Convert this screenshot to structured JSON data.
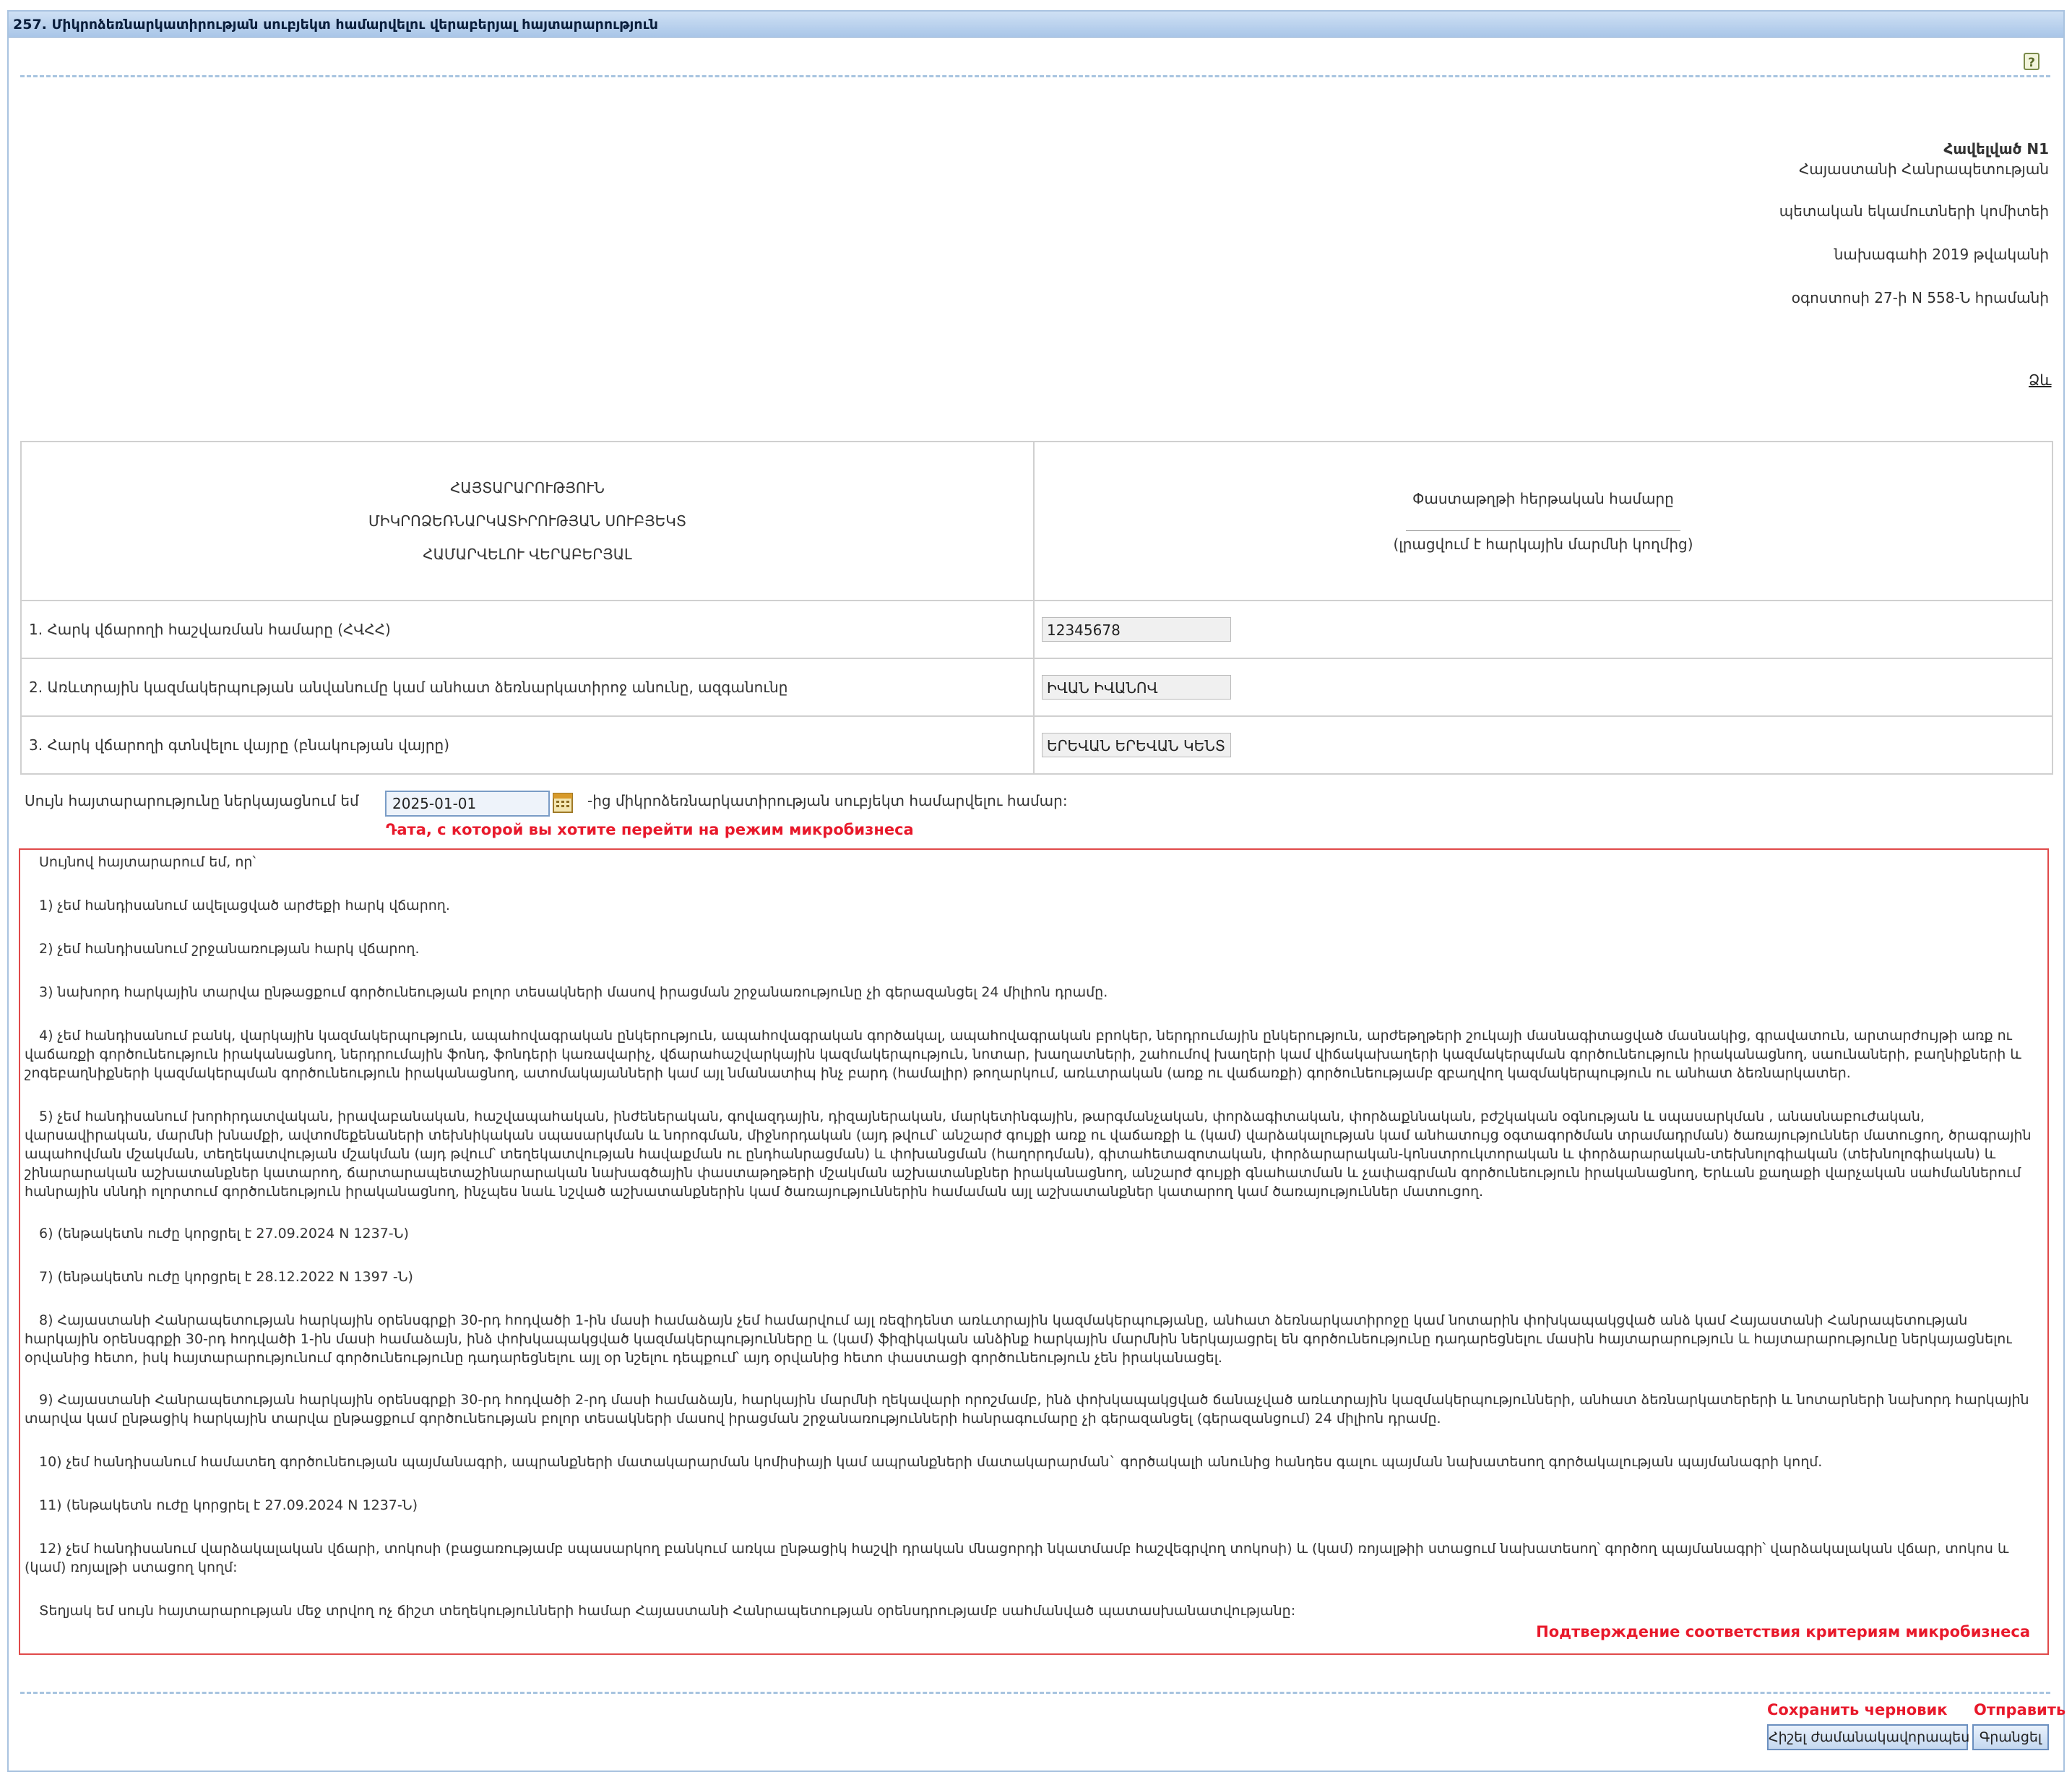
{
  "window": {
    "title": "257. Միկրոձեռնարկատիրության սուբյեկտ համարվելու վերաբերյալ հայտարարություն"
  },
  "appendix": {
    "line1": "Հավելված N1",
    "line2": "Հայաստանի Հանրապետության",
    "line3": "պետական եկամուտների կոմիտեի",
    "line4": "նախագահի 2019 թվականի",
    "line5": "օգոստոսի 27-ի N 558-Ն հրամանի",
    "form_link": "Ձև"
  },
  "header": {
    "title1": "ՀԱՅՏԱՐԱՐՈՒԹՅՈՒՆ",
    "title2": "ՄԻԿՐՈՁԵՌՆԱՐԿԱՏԻՐՈՒԹՅԱՆ ՍՈՒԲՅԵԿՏ",
    "title3": "ՀԱՄԱՐՎԵԼՈՒ ՎԵՐԱԲԵՐՅԱԼ",
    "doc_number_label": "Փաստաթղթի հերթական համարը",
    "doc_number_note": "(լրացվում է հարկային մարմնի կողմից)"
  },
  "fields": [
    {
      "label": "1. Հարկ վճարողի հաշվառման համարը (ՀՎՀՀ)",
      "value": "12345678"
    },
    {
      "label": "2. Առևտրային կազմակերպության անվանումը կամ անհատ ձեռնարկատիրոջ անունը, ազգանունը",
      "value": "ԻՎԱՆ ԻՎԱՆՈՎ"
    },
    {
      "label": "3. Հարկ վճարողի գտնվելու վայրը (բնակության վայրը)",
      "value": "ԵՐԵՎԱՆ ԵՐԵՎԱՆ ԿԵՆՏ"
    }
  ],
  "date_row": {
    "label": "Սույն հայտարարությունը ներկայացնում եմ",
    "value": "2025-01-01",
    "suffix": "-ից միկրոձեռնարկատիրության սուբյեկտ համարվելու համար:",
    "note": "Դата, с которой вы хотите перейти на режим микробизнеса"
  },
  "declaration": {
    "intro": "Սույնով հայտարարում եմ, որ՝",
    "items": [
      "1) չեմ հանդիսանում ավելացված արժեքի հարկ վճարող.",
      "2) չեմ հանդիսանում շրջանառության հարկ վճարող.",
      "3) նախորդ հարկային տարվա ընթացքում գործունեության բոլոր տեսակների մասով իրացման շրջանառությունը չի գերազանցել 24 միլիոն դրամը.",
      "4) չեմ հանդիսանում բանկ, վարկային կազմակերպություն, ապահովագրական ընկերություն, ապահովագրական գործակալ, ապահովագրական բրոկեր, ներդրումային ընկերություն, արժեթղթերի շուկայի մասնագիտացված մասնակից, գրավատուն, արտարժույթի առք ու վաճառքի գործունեություն իրականացնող, ներդրումային ֆոնդ, ֆոնդերի կառավարիչ, վճարահաշվարկային կազմակերպություն, նոտար, խաղատների, շահումով խաղերի կամ վիճակախաղերի կազմակերպման գործունեություն իրականացնող, սաունաների, բաղնիքների և շոգեբաղնիքների կազմակերպման գործունեություն իրականացնող, ատոմակայանների կամ այլ նմանատիպ ինչ բարդ (համալիր) թողարկում, առևտրական (առք ու վաճառքի) գործունեությամբ զբաղվող կազմակերպություն ու անհատ ձեռնարկատեր.",
      "5) չեմ հանդիսանում խորհրդատվական, իրավաբանական, հաշվապահական, ինժեներական, գովազդային, դիզայներական, մարկետինգային, թարգմանչական, փորձագիտական, փորձաքննական, բժշկական օգնության և սպասարկման , անասնաբուժական, վարսավիրական, մարմնի խնամքի, ավտոմեքենաների տեխնիկական սպասարկման և նորոգման, միջնորդական (այդ թվում՝ անշարժ գույքի առք ու վաճառքի և (կամ) վարձակալության կամ անհատույց օգտագործման տրամադրման) ծառայություններ մատուցող, ծրագրային ապահովման մշակման, տեղեկատվության մշակման (այդ թվում՝ տեղեկատվության հավաքման ու ընդհանրացման) և փոխանցման (հաղորդման), գիտահետազոտական, փորձարարական-կոնստրուկտորական և փորձարարական-տեխնոլոգիական (տեխնոլոգիական) և շինարարական աշխատանքներ կատարող, ճարտարապետաշինարարական նախագծային փաստաթղթերի մշակման աշխատանքներ իրականացնող, անշարժ գույքի գնահատման և չափագրման գործունեություն իրականացնող, Երևան քաղաքի վարչական սահմաններում հանրային սննդի ոլորտում գործունեություն իրականացնող, ինչպես նաև նշված աշխատանքներին կամ ծառայություններին համաման այլ աշխատանքներ կատարող կամ ծառայություններ մատուցող.",
      "6) (ենթակետն ուժը կորցրել է 27.09.2024 N 1237-Ն)",
      "7) (ենթակետն ուժը կորցրել է 28.12.2022 N 1397 -Ն)",
      "8) Հայաստանի Հանրապետության հարկային օրենսգրքի 30-րդ հոդվածի 1-ին մասի համաձայն չեմ համարվում այլ ռեզիդենտ առևտրային կազմակերպությանը, անհատ ձեռնարկատիրոջը կամ նոտարին փոխկապակցված անձ կամ Հայաստանի Հանրապետության հարկային օրենսգրքի 30-րդ հոդվածի 1-ին մասի համաձայն, ինձ փոխկապակցված կազմակերպությունները և (կամ) ֆիզիկական անձինք հարկային մարմնին ներկայացրել են գործունեությունը դադարեցնելու մասին հայտարարություն և հայտարարությունը ներկայացնելու օրվանից հետո, իսկ հայտարարությունում գործունեությունը դադարեցնելու այլ օր նշելու դեպքում՝ այդ օրվանից հետո փաստացի գործունեություն չեն իրականացել.",
      "9) Հայաստանի Հանրապետության հարկային օրենսգրքի 30-րդ հոդվածի 2-րդ մասի համաձայն, հարկային մարմնի ղեկավարի որոշմամբ, ինձ փոխկապակցված ճանաչված առևտրային կազմակերպությունների, անհատ ձեռնարկատերերի և նոտարների նախորդ հարկային տարվա կամ ընթացիկ հարկային տարվա ընթացքում գործունեության բոլոր տեսակների մասով իրացման շրջանառությունների հանրագումարը չի գերազանցել (գերազանցում) 24 միլիոն դրամը.",
      "10) չեմ հանդիսանում համատեղ գործունեության պայմանագրի, ապրանքների մատակարարման կոմիսիայի կամ ապրանքների մատակարարման` գործակալի անունից հանդես գալու պայման նախատեսող գործակալության պայմանագրի կողմ.",
      "11) (ենթակետն ուժը կորցրել է 27.09.2024 N 1237-Ն)",
      "12) չեմ հանդիսանում վարձակալական վճարի, տոկոսի (բացառությամբ սպասարկող բանկում առկա ընթացիկ հաշվի դրական մնացորդի նկատմամբ հաշվեգրվող տոկոսի) և (կամ) ռոյալթիի ստացում նախատեսող՝ գործող պայմանագրի՝ վարձակալական վճար, տոկոս և (կամ) ռոյալթի ստացող կողմ:"
    ],
    "closing": "Տեղյակ եմ սույն հայտարարության մեջ տրվող ոչ ճիշտ տեղեկությունների համար Հայաստանի Հանրապետության օրենսդրությամբ սահմանված պատասխանատվությանը:",
    "note": "Подтверждение соответствия критериям микробизнеса"
  },
  "footer": {
    "save_note": "Сохранить черновик",
    "send_note": "Отправить",
    "save_button": "Հիշել ժամանակավորապես",
    "send_button": "Գրանցել"
  }
}
